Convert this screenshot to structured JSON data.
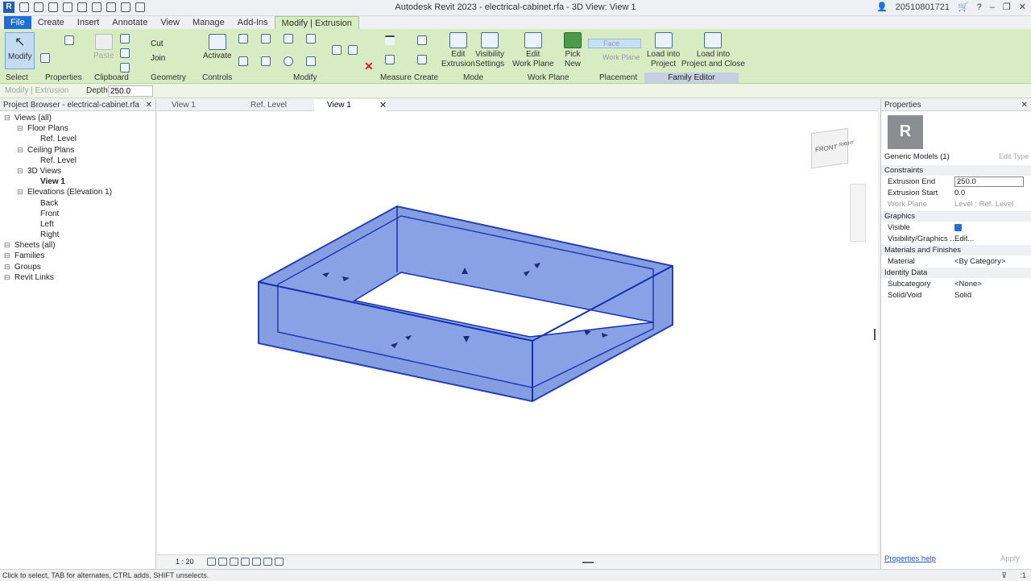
{
  "window": {
    "title": "Autodesk Revit 2023 - electrical-cabinet.rfa - 3D View: View 1",
    "user": "20510801721",
    "logo": "R"
  },
  "ribbon_tabs": [
    "File",
    "Create",
    "Insert",
    "Annotate",
    "View",
    "Manage",
    "Add-Ins",
    "Modify | Extrusion"
  ],
  "ribbon": {
    "modify": "Modify",
    "paste": "Paste",
    "cut": "Cut",
    "join": "Join",
    "activate": "Activate",
    "edit_extrusion": "Edit\nExtrusion",
    "visibility_settings": "Visibility\nSettings",
    "edit_work_plane": "Edit\nWork Plane",
    "pick_new": "Pick\nNew",
    "face": "Face",
    "work_plane": "Work Plane",
    "load_into_project": "Load into\nProject",
    "load_into_project_close": "Load into\nProject and Close"
  },
  "panels": [
    "Select",
    "Properties",
    "Clipboard",
    "Geometry",
    "Controls",
    "Modify",
    "Measure",
    "Create",
    "Mode",
    "Work Plane",
    "Placement",
    "Family Editor"
  ],
  "options_bar": {
    "context": "Modify | Extrusion",
    "depth_label": "Depth",
    "depth_value": "250.0"
  },
  "project_browser": {
    "title": "Project Browser - electrical-cabinet.rfa",
    "items": [
      {
        "label": "Views (all)",
        "level": 0,
        "bold": false
      },
      {
        "label": "Floor Plans",
        "level": 1
      },
      {
        "label": "Ref. Level",
        "level": 2
      },
      {
        "label": "Ceiling Plans",
        "level": 1
      },
      {
        "label": "Ref. Level",
        "level": 2
      },
      {
        "label": "3D Views",
        "level": 1
      },
      {
        "label": "View 1",
        "level": 2,
        "bold": true
      },
      {
        "label": "Elevations (Elevation 1)",
        "level": 1
      },
      {
        "label": "Back",
        "level": 2
      },
      {
        "label": "Front",
        "level": 2
      },
      {
        "label": "Left",
        "level": 2
      },
      {
        "label": "Right",
        "level": 2
      },
      {
        "label": "Sheets (all)",
        "level": 0
      },
      {
        "label": "Families",
        "level": 0
      },
      {
        "label": "Groups",
        "level": 0
      },
      {
        "label": "Revit Links",
        "level": 0
      }
    ]
  },
  "view_tabs": [
    "View 1",
    "Ref. Level",
    "View 1"
  ],
  "viewcube": {
    "front": "FRONT",
    "right": "RIGHT"
  },
  "view_scale": "1 : 20",
  "properties": {
    "title": "Properties",
    "type": "Generic Models (1)",
    "edit_type": "Edit Type",
    "sections": [
      {
        "name": "Constraints",
        "rows": [
          [
            "Extrusion End",
            "250.0"
          ],
          [
            "Extrusion Start",
            "0.0"
          ],
          [
            "Work Plane",
            "Level : Ref. Level"
          ]
        ]
      },
      {
        "name": "Graphics",
        "rows": [
          [
            "Visible",
            ""
          ],
          [
            "Visibility/Graphics ...",
            "Edit..."
          ]
        ]
      },
      {
        "name": "Materials and Finishes",
        "rows": [
          [
            "Material",
            "<By Category>"
          ]
        ]
      },
      {
        "name": "Identity Data",
        "rows": [
          [
            "Subcategory",
            "<None>"
          ],
          [
            "Solid/Void",
            "Solid"
          ]
        ]
      }
    ],
    "help": "Properties help",
    "apply": "Apply"
  },
  "status": {
    "text": "Click to select, TAB for alternates, CTRL adds, SHIFT unselects.",
    "selection_count": ":1"
  },
  "colors": {
    "ribbon": "#d7ecc2",
    "accent": "#1e6fd6",
    "solid_fill": "#7b96e0",
    "solid_edge": "#1530b0"
  }
}
